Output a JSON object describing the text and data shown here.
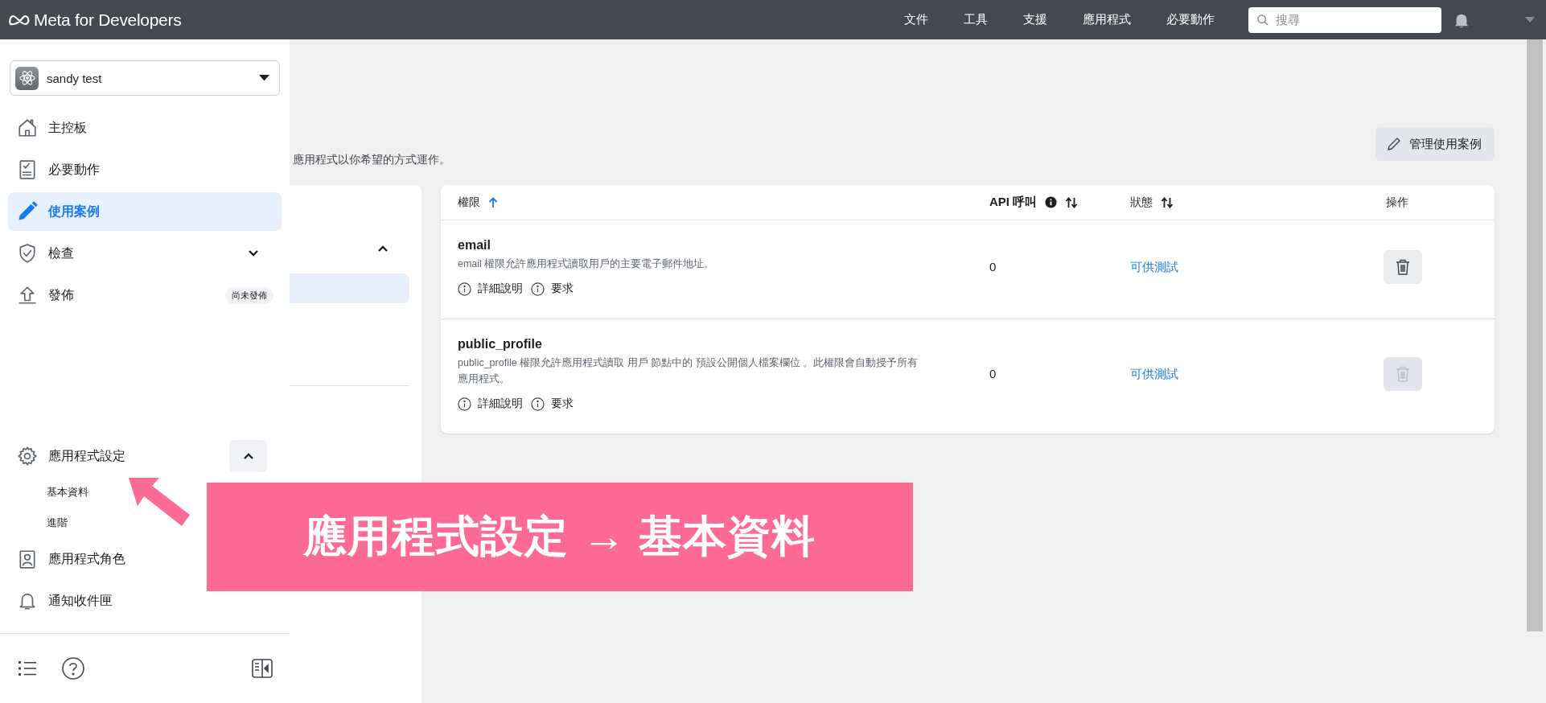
{
  "topbar": {
    "logo": "Meta for Developers",
    "nav": [
      {
        "label": "文件"
      },
      {
        "label": "工具"
      },
      {
        "label": "支援"
      },
      {
        "label": "應用程式"
      },
      {
        "label": "必要動作"
      }
    ],
    "search": {
      "placeholder": "搜尋"
    }
  },
  "sidebar": {
    "app_selector": {
      "name": "sandy test"
    },
    "items": [
      {
        "label": "主控板",
        "selected": false
      },
      {
        "label": "必要動作",
        "selected": false
      },
      {
        "label": "使用案例",
        "selected": true
      },
      {
        "label": "檢查",
        "selected": false,
        "expanded": false
      },
      {
        "label": "發佈",
        "selected": false,
        "badge": "尚未發佈"
      }
    ],
    "bottom_items": [
      {
        "label": "應用程式設定",
        "selected": false,
        "expanded": true,
        "children": [
          {
            "label": "基本資料"
          },
          {
            "label": "進階"
          }
        ]
      },
      {
        "label": "應用程式角色",
        "selected": false
      },
      {
        "label": "通知收件匣",
        "selected": false
      }
    ]
  },
  "main": {
    "description": "應用程式以你希望的方式運作。",
    "manage_button": "管理使用案例",
    "side_panel": {
      "expanded": true
    },
    "table": {
      "columns": [
        {
          "label": "權限",
          "sorted": true
        },
        {
          "label": "API 呼叫",
          "info": true,
          "sorted": false
        },
        {
          "label": "狀態",
          "sorted": false
        },
        {
          "label": "操作"
        }
      ],
      "rows": [
        {
          "name": "email",
          "description": "email 權限允許應用程式讀取用戶的主要電子郵件地址。",
          "links": [
            "詳細說明",
            "要求"
          ],
          "api_calls": "0",
          "status": "可供測試",
          "delete_disabled": false
        },
        {
          "name": "public_profile",
          "description": "public_profile 權限允許應用程式讀取 用戶 節點中的 預設公開個人檔案欄位 。此權限會自動授予所有應用程式。",
          "links": [
            "詳細說明",
            "要求"
          ],
          "api_calls": "0",
          "status": "可供測試",
          "delete_disabled": true
        }
      ]
    }
  },
  "callout": {
    "text": "應用程式設定 → 基本資料"
  }
}
